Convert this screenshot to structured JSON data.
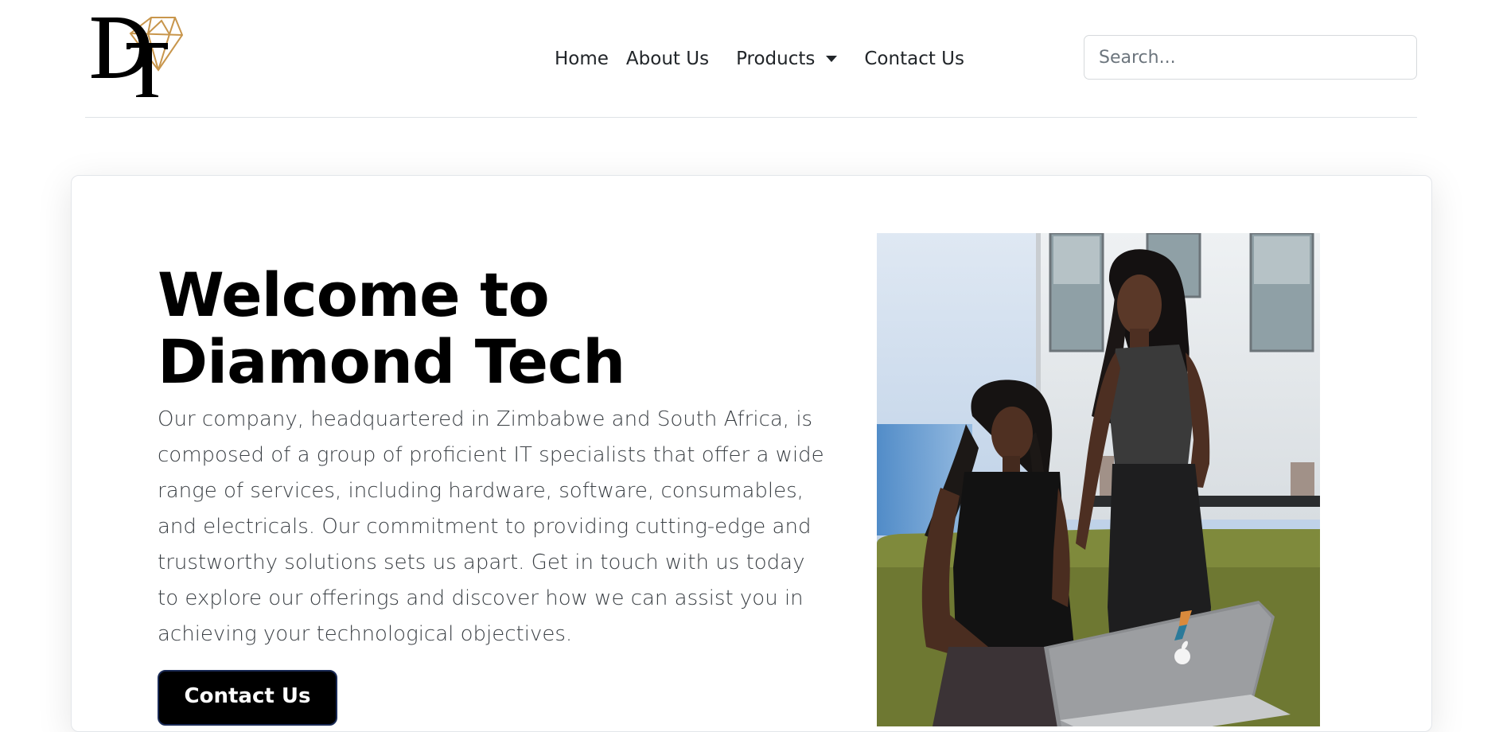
{
  "header": {
    "logo_letters": "DT",
    "nav": {
      "home": "Home",
      "about": "About Us",
      "products": "Products",
      "contact": "Contact Us"
    },
    "search": {
      "placeholder": "Search..."
    }
  },
  "hero": {
    "title_line1": "Welcome to",
    "title_line2": "Diamond Tech",
    "description": "Our company, headquartered in Zimbabwe and South Africa, is composed of a group of proficient IT specialists that offer a wide range of services, including hardware, software, consumables, and electricals. Our commitment to providing cutting-edge and trustworthy solutions sets us apart. Get in touch with us today to explore our offerings and discover how we can assist you in achieving your technological objectives.",
    "cta_label": "Contact Us"
  },
  "colors": {
    "logo_gold": "#c8964c",
    "button_bg": "#000000",
    "button_border": "#1a2a55"
  },
  "icons": {
    "logo": "diamond-tech-logo",
    "dropdown": "caret-down-icon"
  }
}
